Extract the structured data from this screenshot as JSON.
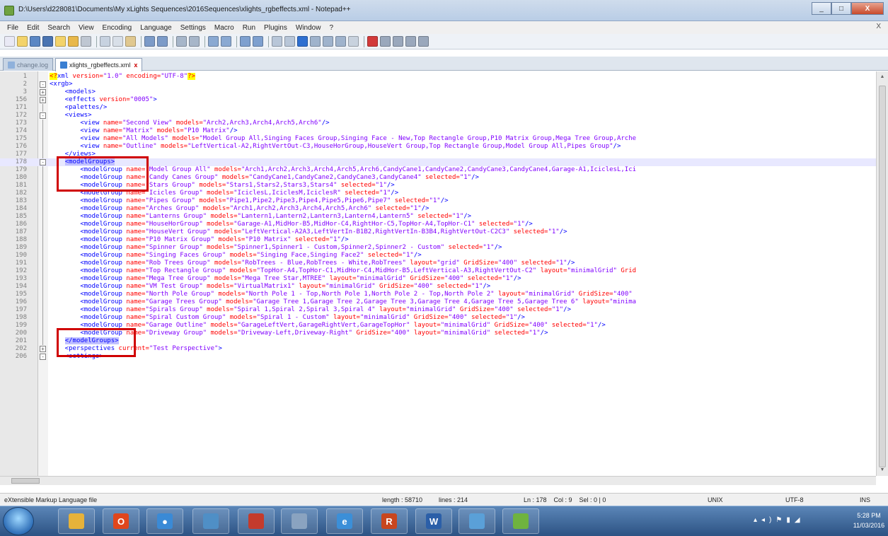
{
  "window": {
    "title": "D:\\Users\\d228081\\Documents\\My xLights Sequences\\2016Sequences\\xlights_rgbeffects.xml - Notepad++",
    "app_icon": "notepad-plus-plus-icon",
    "close_label": "X"
  },
  "menu": [
    "File",
    "Edit",
    "Search",
    "View",
    "Encoding",
    "Language",
    "Settings",
    "Macro",
    "Run",
    "Plugins",
    "Window",
    "?"
  ],
  "menu_close": "X",
  "tabs": [
    {
      "label": "change.log"
    },
    {
      "label": "xlights_rgbeffects.xml",
      "close": "x"
    }
  ],
  "lines": [
    {
      "num": "1"
    },
    {
      "num": "2"
    },
    {
      "num": "3"
    },
    {
      "num": "156"
    },
    {
      "num": "171"
    },
    {
      "num": "172"
    },
    {
      "num": "173"
    },
    {
      "num": "174"
    },
    {
      "num": "175"
    },
    {
      "num": "176"
    },
    {
      "num": "177"
    },
    {
      "num": "178"
    },
    {
      "num": "179"
    },
    {
      "num": "180"
    },
    {
      "num": "181"
    },
    {
      "num": "182"
    },
    {
      "num": "183"
    },
    {
      "num": "184"
    },
    {
      "num": "185"
    },
    {
      "num": "186"
    },
    {
      "num": "187"
    },
    {
      "num": "188"
    },
    {
      "num": "189"
    },
    {
      "num": "190"
    },
    {
      "num": "191"
    },
    {
      "num": "192"
    },
    {
      "num": "193"
    },
    {
      "num": "194"
    },
    {
      "num": "195"
    },
    {
      "num": "196"
    },
    {
      "num": "197"
    },
    {
      "num": "198"
    },
    {
      "num": "199"
    },
    {
      "num": "200"
    },
    {
      "num": "201"
    },
    {
      "num": "202"
    },
    {
      "num": "206"
    }
  ],
  "status": {
    "file_type": "eXtensible Markup Language file",
    "length": "length : 58710",
    "lines": "lines : 214",
    "position": "Ln : 178    Col : 9    Sel : 0 | 0",
    "eol": "UNIX",
    "encoding": "UTF-8",
    "mode": "INS"
  },
  "taskbar": {
    "time": "5:28 PM",
    "date": "11/03/2016",
    "apps": [
      {
        "icon": "file-explorer-icon",
        "color": "#e6b23a",
        "glyph": ""
      },
      {
        "icon": "office-icon",
        "color": "#e0461c",
        "glyph": "O"
      },
      {
        "icon": "chrome-icon",
        "color": "#3a8ad6",
        "glyph": "●"
      },
      {
        "icon": "network-icon",
        "color": "#4f8fc6",
        "glyph": ""
      },
      {
        "icon": "outlook-icon",
        "color": "#c43b2c",
        "glyph": ""
      },
      {
        "icon": "image-viewer-icon",
        "color": "#8aa3c0",
        "glyph": ""
      },
      {
        "icon": "internet-explorer-icon",
        "color": "#3b8fd8",
        "glyph": "e"
      },
      {
        "icon": "r-app-icon",
        "color": "#c8461e",
        "glyph": "R"
      },
      {
        "icon": "word-icon",
        "color": "#2b5fa8",
        "glyph": "W"
      },
      {
        "icon": "paint-icon",
        "color": "#5aa0d8",
        "glyph": ""
      },
      {
        "icon": "notepad-plus-plus-icon",
        "color": "#6fb33f",
        "glyph": ""
      }
    ]
  }
}
